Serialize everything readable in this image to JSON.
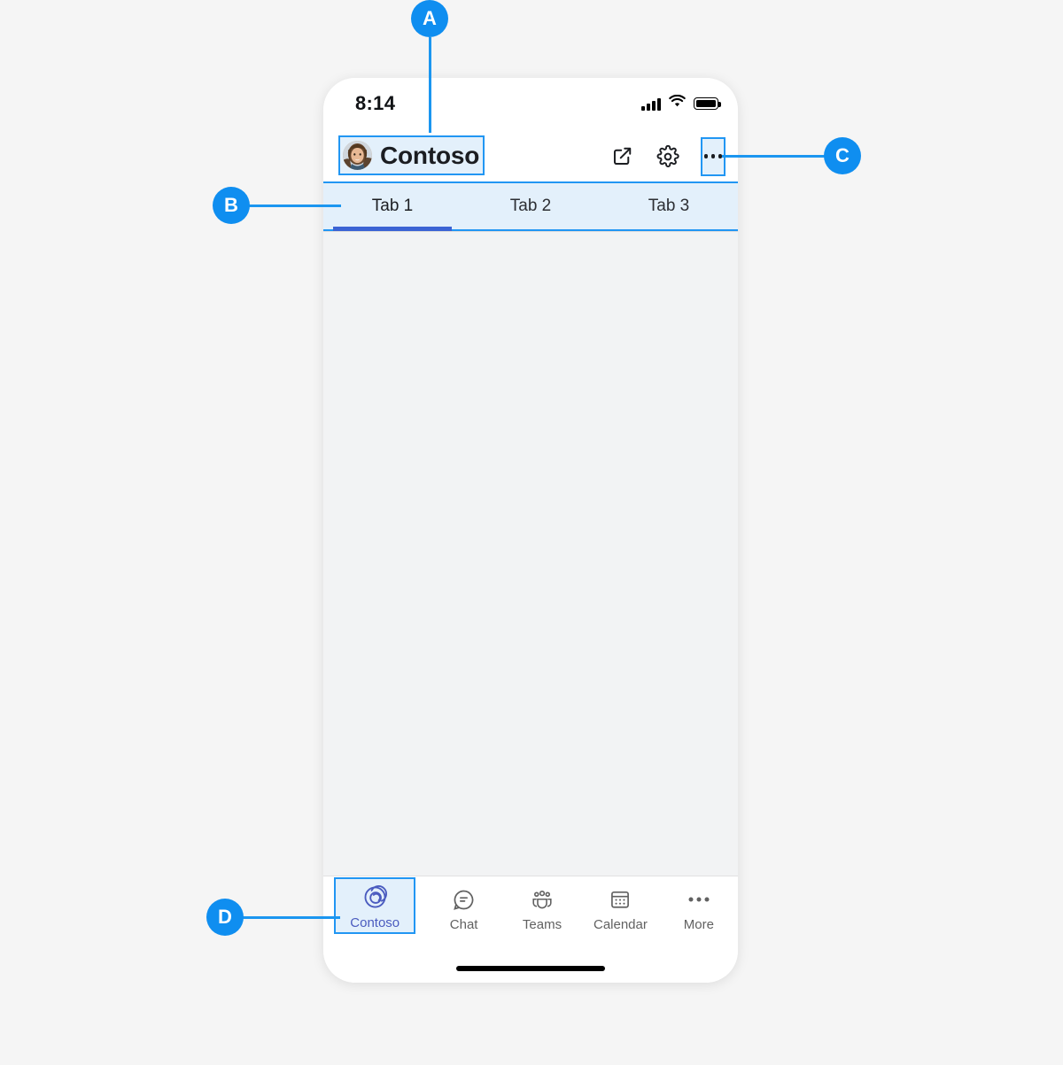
{
  "annotations": {
    "a": {
      "label": "A",
      "target": "app-title-with-avatar"
    },
    "b": {
      "label": "B",
      "target": "tab-strip"
    },
    "c": {
      "label": "C",
      "target": "header-overflow-button"
    },
    "d": {
      "label": "D",
      "target": "bottom-nav-selected-app"
    }
  },
  "colors": {
    "accent_blue": "#0f8ef0",
    "highlight_fill": "#e3f0fb",
    "highlight_border": "#2196f3",
    "active_tab_underline": "#3b63d4",
    "page_background": "#f5f5f5",
    "content_background": "#f2f3f4",
    "app_brand": "#4a5bbf"
  },
  "phone": {
    "status_bar": {
      "time": "8:14",
      "icons": [
        "cellular-signal-icon",
        "wifi-icon",
        "battery-icon"
      ]
    },
    "header": {
      "avatar_name": "avatar",
      "title": "Contoso",
      "actions": [
        {
          "name": "open-in-new-icon",
          "label": "Open in new window"
        },
        {
          "name": "gear-icon",
          "label": "Settings"
        },
        {
          "name": "more-icon",
          "label": "More options"
        }
      ]
    },
    "tabs": [
      {
        "label": "Tab 1",
        "active": true
      },
      {
        "label": "Tab 2",
        "active": false
      },
      {
        "label": "Tab 3",
        "active": false
      }
    ],
    "content": {
      "body": ""
    },
    "bottom_nav": [
      {
        "label": "Contoso",
        "icon": "contoso-spiral-icon",
        "selected": true
      },
      {
        "label": "Chat",
        "icon": "chat-bubble-icon",
        "selected": false
      },
      {
        "label": "Teams",
        "icon": "teams-people-icon",
        "selected": false
      },
      {
        "label": "Calendar",
        "icon": "calendar-icon",
        "selected": false
      },
      {
        "label": "More",
        "icon": "ellipsis-icon",
        "selected": false
      }
    ],
    "home_indicator": "home-indicator"
  }
}
